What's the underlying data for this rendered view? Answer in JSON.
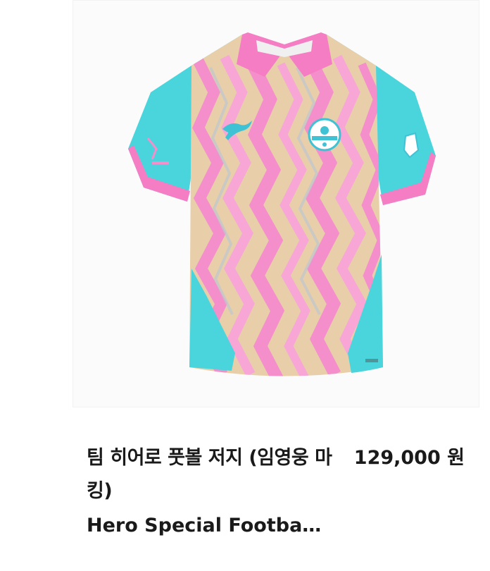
{
  "product": {
    "image_alt": "Hero Special Football Jersey",
    "title_ko": "팀 히어로 풋볼 저지 (임영웅 마킹)",
    "title_en": "Hero Special Footba…",
    "price": "129,000 원"
  },
  "colors": {
    "jersey_pink": "#f48fcb",
    "jersey_beige": "#e8cfaa",
    "jersey_teal": "#4ad4dc",
    "collar_pink": "#f57dc4",
    "text": "#1a1a1a"
  },
  "icons": {
    "brand_logo": "puma-cat-logo",
    "club_crest": "team-crest-badge"
  }
}
